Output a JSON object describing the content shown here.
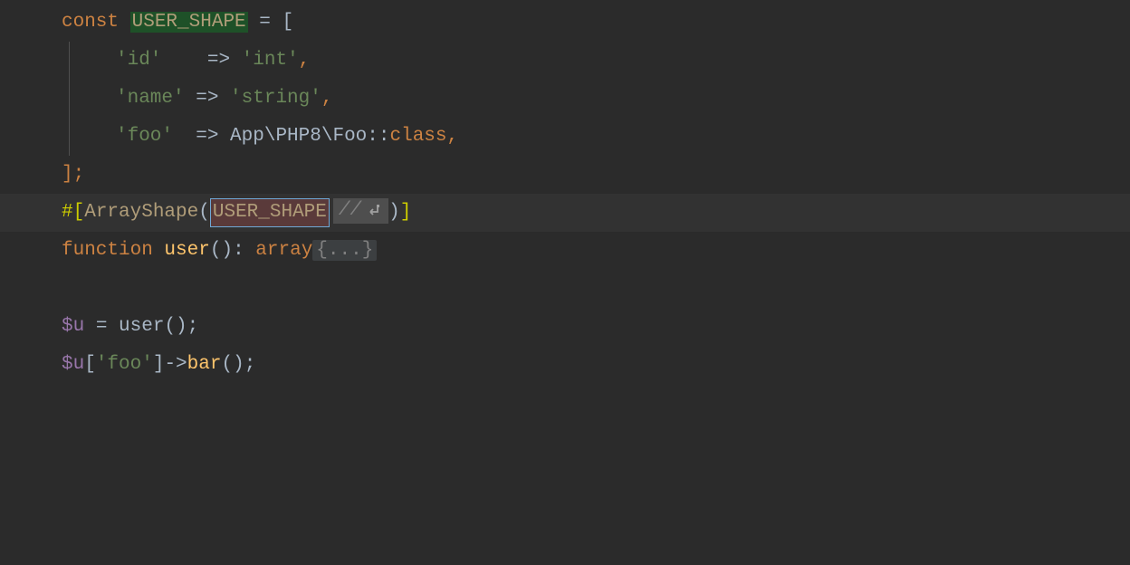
{
  "colors": {
    "background": "#2b2b2b",
    "highlight": "#323232",
    "keyword": "#cc8242",
    "string": "#6a8759",
    "constant_bg": "#1e5128",
    "selection_bg": "#5a3a3a",
    "selection_border": "#6fa8d6",
    "fn": "#fec56c",
    "var": "#9876aa",
    "bracket": "#cccc00"
  },
  "code": {
    "l1": {
      "kw_const": "const ",
      "const_name": "USER_SHAPE",
      "rest": " = ["
    },
    "l2": {
      "key": "'id'",
      "pad": "   ",
      "arrow": " => ",
      "val": "'int'",
      "comma": ","
    },
    "l3": {
      "key": "'name'",
      "pad": " ",
      "arrow": "=> ",
      "val": "'string'",
      "comma": ","
    },
    "l4": {
      "key": "'foo'",
      "pad": "  ",
      "arrow": "=> ",
      "ns": "App\\PHP8\\Foo",
      "dcolon": "::",
      "class_kw": "class",
      "comma": ","
    },
    "l5": {
      "close": "];"
    },
    "l6": {
      "attr_open": "#[",
      "attr_name": "ArrayShape",
      "paren_open": "(",
      "const_ref": "USER_SHAPE",
      "hint_slash": "//",
      "paren_close": ")",
      "attr_close": "]"
    },
    "l7": {
      "kw_function": "function ",
      "fn_name": "user",
      "parens": "()",
      "colon": ": ",
      "array_kw": "array",
      "fold": "{...}"
    },
    "l8": {
      "blank": ""
    },
    "l9": {
      "var": "$u",
      "eq": " = ",
      "fn": "user",
      "call": "();"
    },
    "l10": {
      "var": "$u",
      "bracket_open": "[",
      "key": "'foo'",
      "bracket_close": "]",
      "arrow": "->",
      "method": "bar",
      "call": "();"
    }
  }
}
